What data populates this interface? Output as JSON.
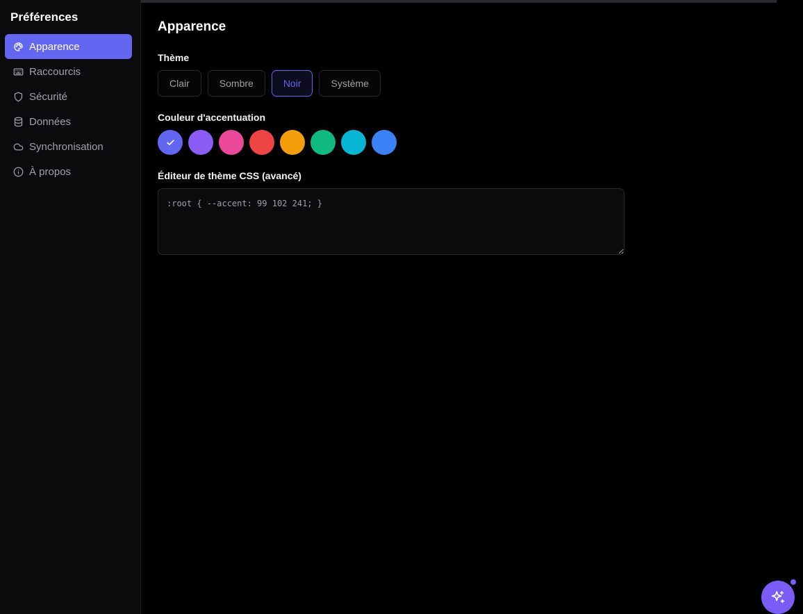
{
  "sidebar": {
    "title": "Préférences",
    "items": [
      {
        "label": "Apparence",
        "icon": "palette-icon",
        "active": true
      },
      {
        "label": "Raccourcis",
        "icon": "keyboard-icon",
        "active": false
      },
      {
        "label": "Sécurité",
        "icon": "shield-icon",
        "active": false
      },
      {
        "label": "Données",
        "icon": "database-icon",
        "active": false
      },
      {
        "label": "Synchronisation",
        "icon": "cloud-icon",
        "active": false
      },
      {
        "label": "À propos",
        "icon": "info-icon",
        "active": false
      }
    ]
  },
  "main": {
    "title": "Apparence",
    "theme": {
      "label": "Thème",
      "options": [
        "Clair",
        "Sombre",
        "Noir",
        "Système"
      ],
      "selected": "Noir"
    },
    "accent": {
      "label": "Couleur d'accentuation",
      "colors": [
        "#6366f1",
        "#8b5cf6",
        "#ec4899",
        "#ef4444",
        "#f59e0b",
        "#10b981",
        "#06b6d4",
        "#3b82f6"
      ],
      "selected_index": 0
    },
    "css_editor": {
      "label": "Éditeur de thème CSS (avancé)",
      "value": ":root { --accent: 99 102 241; }"
    }
  },
  "fab": {
    "icon": "sparkles-icon"
  },
  "colors": {
    "accent": "#6366f1",
    "fab": "#7c5cf6"
  }
}
